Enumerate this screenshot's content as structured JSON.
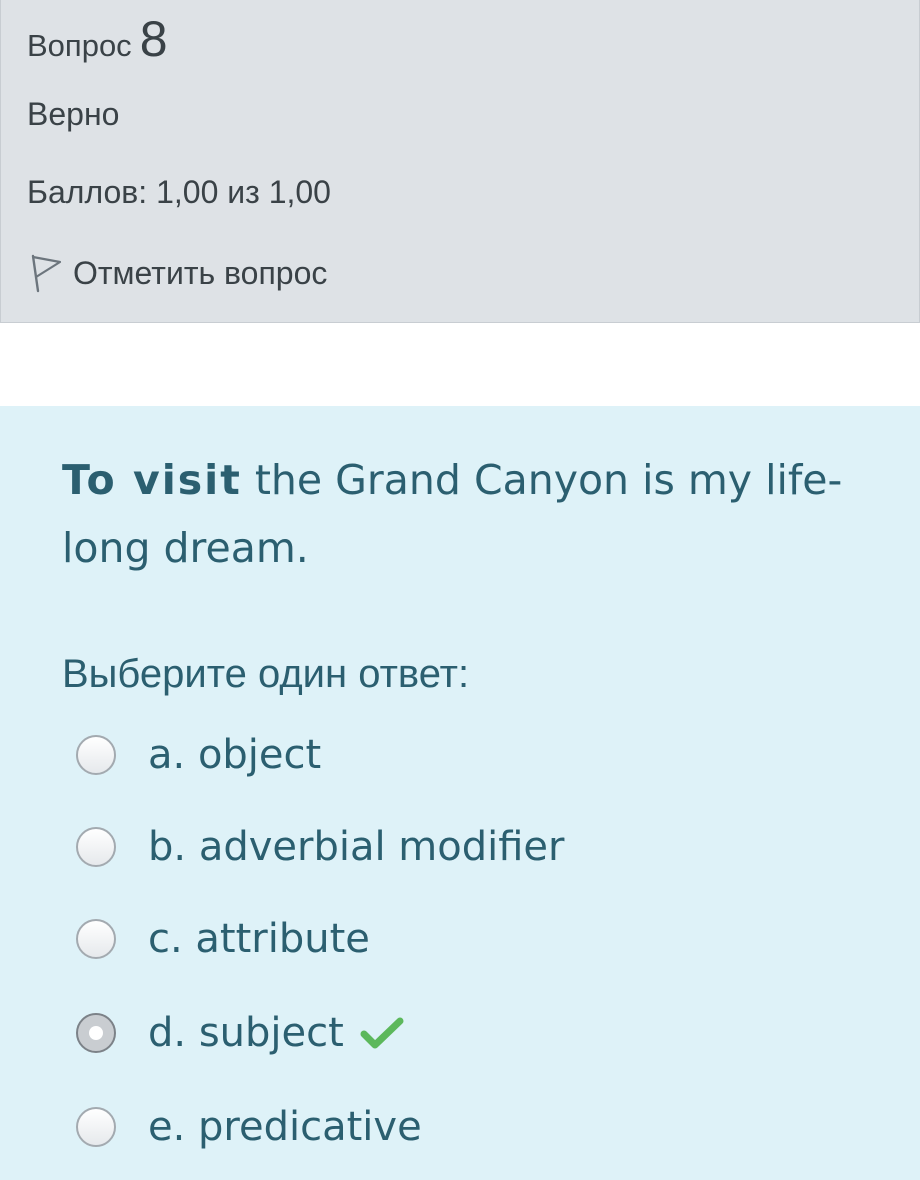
{
  "question_info": {
    "label": "Вопрос",
    "number": "8",
    "state": "Верно",
    "grade": "Баллов: 1,00 из 1,00",
    "flag_label": "Отметить вопрос",
    "flag_icon": "flag-outline-icon"
  },
  "question": {
    "text_emphasis": "To visit",
    "text_rest": " the Grand Canyon is my life-long dream.",
    "prompt": "Выберите один ответ:",
    "answers": [
      {
        "label": "a. object",
        "selected": false,
        "correct": false
      },
      {
        "label": "b. adverbial modifier",
        "selected": false,
        "correct": false
      },
      {
        "label": "c. attribute",
        "selected": false,
        "correct": false
      },
      {
        "label": "d. subject",
        "selected": true,
        "correct": true
      },
      {
        "label": "e. predicative",
        "selected": false,
        "correct": false
      }
    ],
    "correct_icon": "checkmark-icon"
  },
  "colors": {
    "info_background": "#dee2e6",
    "content_background": "#def2f8",
    "text_primary": "#2b5f70",
    "text_info": "#3a4247",
    "correct_check": "#5cb85c"
  }
}
